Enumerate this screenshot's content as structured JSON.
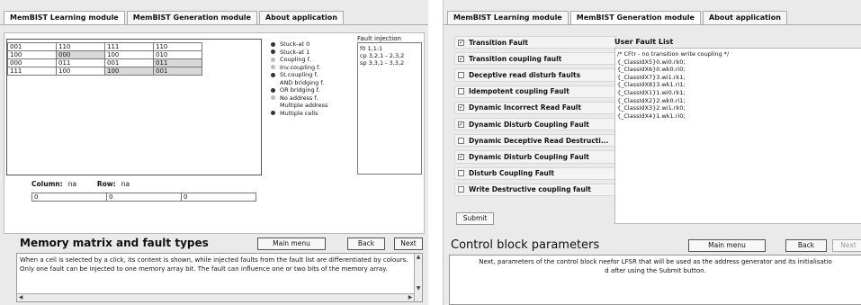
{
  "left": {
    "tabs": [
      "MemBIST Learning module",
      "MemBIST Generation module",
      "About application"
    ],
    "active_tab": 0,
    "matrix": [
      [
        "001",
        "110",
        "111",
        "110"
      ],
      [
        "100",
        "000",
        "100",
        "010"
      ],
      [
        "000",
        "011",
        "001",
        "011"
      ],
      [
        "111",
        "100",
        "100",
        "001"
      ]
    ],
    "fault_types": [
      {
        "label": "Stuck-at 0",
        "state": "on"
      },
      {
        "label": "Stuck-at 1",
        "state": "on"
      },
      {
        "label": "Coupling f.",
        "state": "off"
      },
      {
        "label": "Inv.coupling f.",
        "state": "off"
      },
      {
        "label": "St.coupling f.",
        "state": "on"
      },
      {
        "label": "AND bridging f.",
        "state": "none"
      },
      {
        "label": "OR bridging f.",
        "state": "on"
      },
      {
        "label": "No address f.",
        "state": "off"
      },
      {
        "label": "Multiple address",
        "state": "none"
      },
      {
        "label": "Multiple cells",
        "state": "on"
      }
    ],
    "fault_injection": {
      "title": "Fault injection",
      "items": [
        "f0 1,1:1",
        "cp 3,2,1 - 2,3,2",
        "sp 3,3,1 - 3,3,2"
      ]
    },
    "column_label": "Column:",
    "column_value": "na",
    "row_label": "Row:",
    "row_value": "na",
    "bits": [
      "0",
      "0",
      "0"
    ],
    "section_title": "Memory matrix and fault types",
    "buttons": {
      "main_menu": "Main menu",
      "back": "Back",
      "next": "Next"
    },
    "description": "When a cell is selected by a click, its content is shown, while injected faults from the fault list are differentiated by colours. Only one fault can be injected to one memory array bit. The fault can influence one or two bits of the memory array."
  },
  "right": {
    "tabs": [
      "MemBIST Learning module",
      "MemBIST Generation module",
      "About application"
    ],
    "active_tab": 1,
    "faults": [
      {
        "label": "Transition Fault",
        "checked": true
      },
      {
        "label": "Transition coupling fault",
        "checked": true
      },
      {
        "label": "Deceptive read disturb faults",
        "checked": false
      },
      {
        "label": "Idempotent coupling Fault",
        "checked": false
      },
      {
        "label": "Dynamic Incorrect Read Fault",
        "checked": true
      },
      {
        "label": "Dynamic Disturb Coupling Fault",
        "checked": true
      },
      {
        "label": "Dynamic Deceptive Read Destructi...",
        "checked": false
      },
      {
        "label": "Dynamic Disturb Coupling Fault",
        "checked": true
      },
      {
        "label": "Disturb Coupling Fault",
        "checked": false
      },
      {
        "label": "Write Destructive coupling fault",
        "checked": false
      }
    ],
    "submit": "Submit",
    "user_fault_list_title": "User Fault List",
    "user_fault_list": [
      "/* CFtr - no transition write coupling */",
      "{_ClassIdX5}0.wi0.rk0;",
      "{_ClassIdX6}0.wk0.ri0;",
      "{_ClassIdX7}3.wi1.rk1;",
      "{_ClassIdX8}3.wk1.ri1;",
      "{_ClassIdX1}1.wi0.rk1;",
      "{_ClassIdX2}2.wk0.ri1;",
      "{_ClassIdX3}2.wi1.rk0;",
      "{_ClassIdX4}1.wk1.ri0;"
    ],
    "section_title": "Control block parameters",
    "buttons": {
      "main_menu": "Main menu",
      "back": "Back",
      "next": "Next"
    },
    "description_line1": "Next, parameters of the control block neefor LFSR that will be used as the address generator and its initialisatio",
    "description_line2": "d after using the Submit button."
  }
}
